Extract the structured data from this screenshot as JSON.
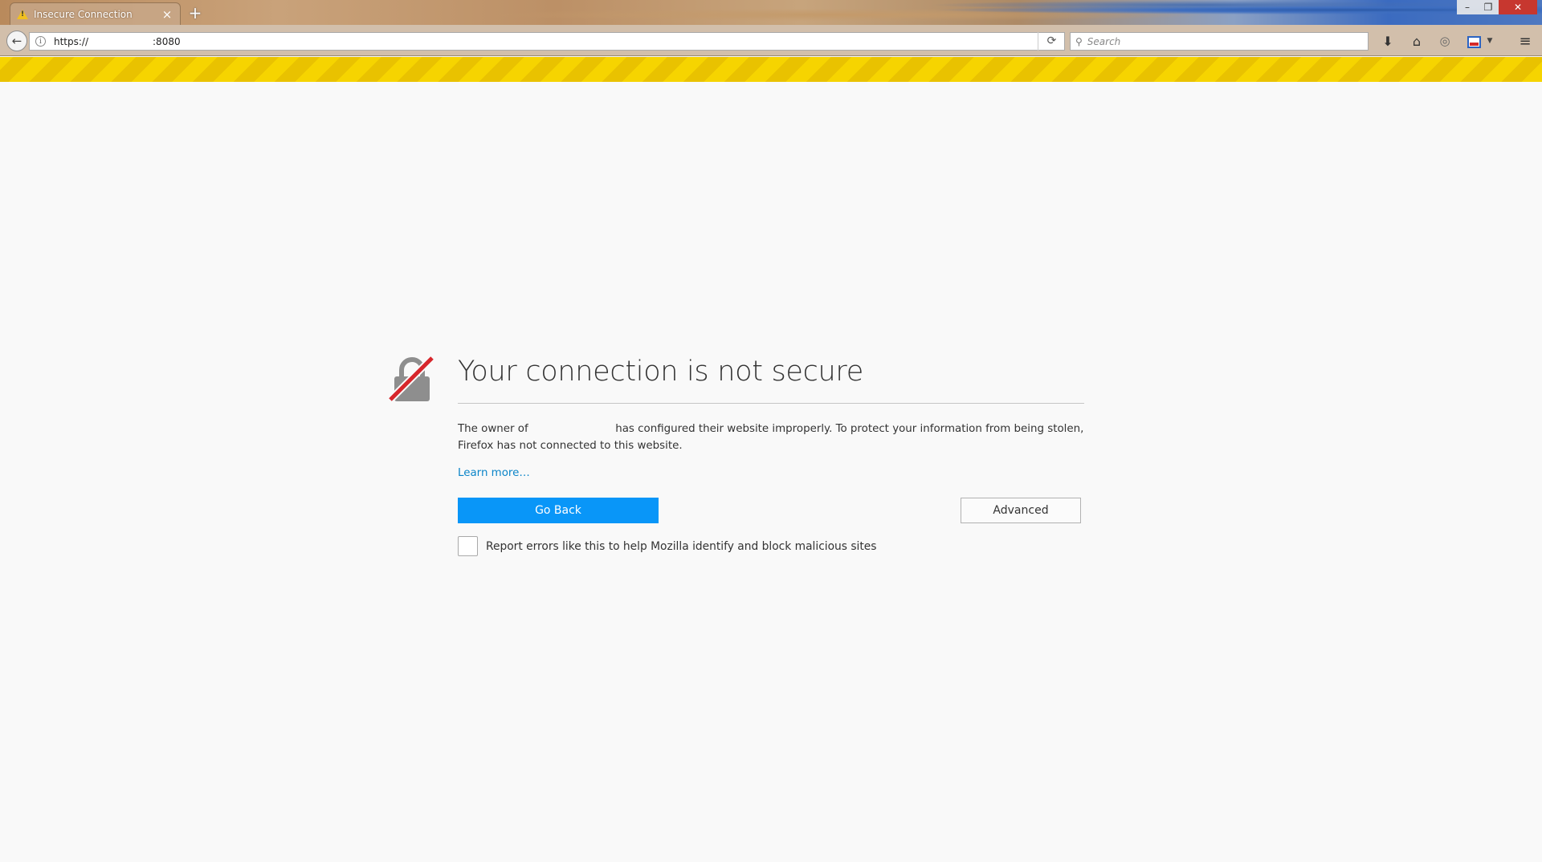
{
  "window": {
    "tab_title": "Insecure Connection",
    "tab_close_glyph": "×",
    "new_tab_glyph": "+",
    "minimize_glyph": "–",
    "restore_glyph": "❐",
    "close_glyph": "✕"
  },
  "navbar": {
    "back_glyph": "←",
    "info_glyph": "i",
    "url_protocol": "https://",
    "url_port": ":8080",
    "reload_glyph": "⟳",
    "search_glyph": "⚲",
    "search_placeholder": "Search",
    "download_glyph": "⬇",
    "home_glyph": "⌂",
    "sync_glyph": "◎",
    "dropdown_glyph": "▼",
    "menu_glyph": "≡"
  },
  "error_page": {
    "title": "Your connection is not secure",
    "desc_prefix": "The owner of",
    "desc_suffix": "has configured their website improperly. To protect your information from being stolen, Firefox has not connected to this website.",
    "learn_more": "Learn more…",
    "go_back_label": "Go Back",
    "advanced_label": "Advanced",
    "report_label": "Report errors like this to help Mozilla identify and block malicious sites"
  },
  "colors": {
    "primary_button": "#0996f8",
    "link": "#0a84c8",
    "warning_stripe": "#f6d400",
    "lock_slash": "#d7262b"
  },
  "icons": {
    "tab": "warning-icon",
    "lock": "broken-lock-icon",
    "back": "back-arrow-icon",
    "info": "info-icon",
    "reload": "reload-icon",
    "search": "search-icon",
    "download": "download-icon",
    "home": "home-icon",
    "sync": "sync-icon",
    "extension": "extension-icon",
    "menu": "hamburger-menu-icon"
  }
}
